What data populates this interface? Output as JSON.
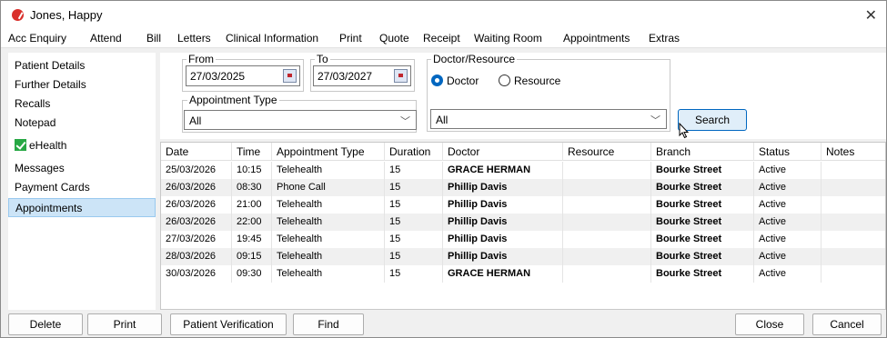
{
  "window": {
    "title": "Jones, Happy"
  },
  "menu": [
    "Acc Enquiry",
    "Attend",
    "Bill",
    "Letters",
    "Clinical Information",
    "Print",
    "Quote",
    "Receipt",
    "Waiting Room",
    "Appointments",
    "Extras"
  ],
  "sidebar": {
    "items": [
      {
        "label": "Patient Details"
      },
      {
        "label": "Further Details"
      },
      {
        "label": "Recalls"
      },
      {
        "label": "Notepad"
      },
      {
        "label": "eHealth",
        "checked": true
      },
      {
        "label": "Messages"
      },
      {
        "label": "Payment Cards"
      },
      {
        "label": "Appointments",
        "selected": true
      }
    ]
  },
  "filters": {
    "from_label": "From",
    "from_value": "27/03/2025",
    "to_label": "To",
    "to_value": "27/03/2027",
    "doctor_resource_label": "Doctor/Resource",
    "radio_doctor": "Doctor",
    "radio_resource": "Resource",
    "selected_radio": "Doctor",
    "appointment_type_label": "Appointment Type",
    "appointment_type_value": "All",
    "doctor_value": "All",
    "search_label": "Search"
  },
  "table": {
    "columns": [
      "Date",
      "Time",
      "Appointment Type",
      "Duration",
      "Doctor",
      "Resource",
      "Branch",
      "Status",
      "Notes"
    ],
    "rows": [
      [
        "25/03/2026",
        "10:15",
        "Telehealth",
        "15",
        "GRACE HERMAN",
        "",
        "Bourke Street",
        "Active",
        ""
      ],
      [
        "26/03/2026",
        "08:30",
        "Phone Call",
        "15",
        "Phillip Davis",
        "",
        "Bourke Street",
        "Active",
        ""
      ],
      [
        "26/03/2026",
        "21:00",
        "Telehealth",
        "15",
        "Phillip Davis",
        "",
        "Bourke Street",
        "Active",
        ""
      ],
      [
        "26/03/2026",
        "22:00",
        "Telehealth",
        "15",
        "Phillip Davis",
        "",
        "Bourke Street",
        "Active",
        ""
      ],
      [
        "27/03/2026",
        "19:45",
        "Telehealth",
        "15",
        "Phillip Davis",
        "",
        "Bourke Street",
        "Active",
        ""
      ],
      [
        "28/03/2026",
        "09:15",
        "Telehealth",
        "15",
        "Phillip Davis",
        "",
        "Bourke Street",
        "Active",
        ""
      ],
      [
        "30/03/2026",
        "09:30",
        "Telehealth",
        "15",
        "GRACE HERMAN",
        "",
        "Bourke Street",
        "Active",
        ""
      ]
    ]
  },
  "buttons": {
    "delete": "Delete",
    "print": "Print",
    "patient_verification": "Patient Verification",
    "find": "Find",
    "close": "Close",
    "cancel": "Cancel"
  },
  "colors": {
    "accent": "#0067c0",
    "selection": "#cce4f7",
    "app_icon": "#d9302b",
    "ehealth_check": "#27a844"
  }
}
